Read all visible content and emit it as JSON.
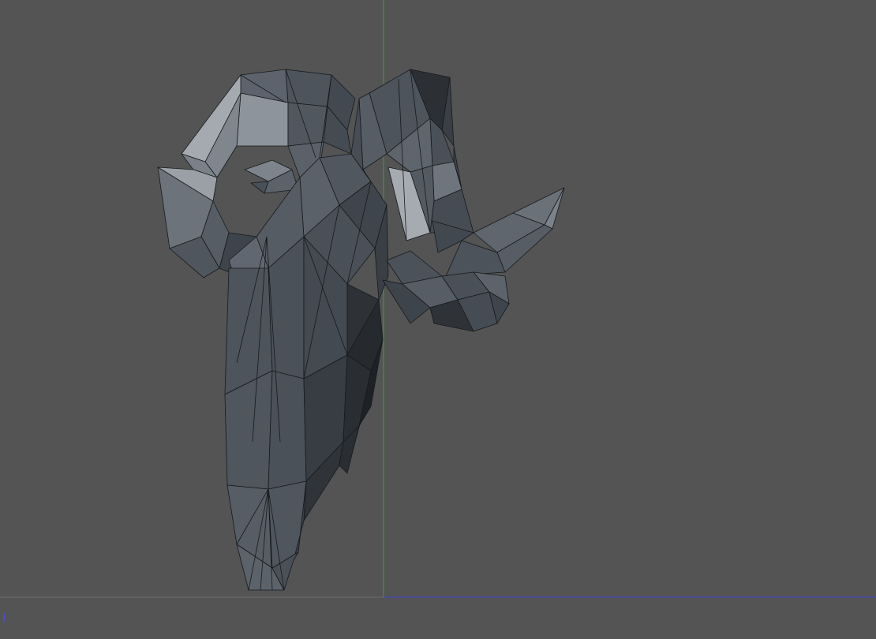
{
  "viewport": {
    "background_color": "#545454",
    "horizon_line_color": "#6a6a6a",
    "vertical_axis_color": "#2ea82e",
    "horizontal_axis_color": "#4646d8"
  },
  "model": {
    "type": "low-poly ram skull",
    "fill_color": "#4a5058",
    "edge_color": "#1a1d21"
  },
  "axis_marker_icon": "axis-gizmo-icon"
}
